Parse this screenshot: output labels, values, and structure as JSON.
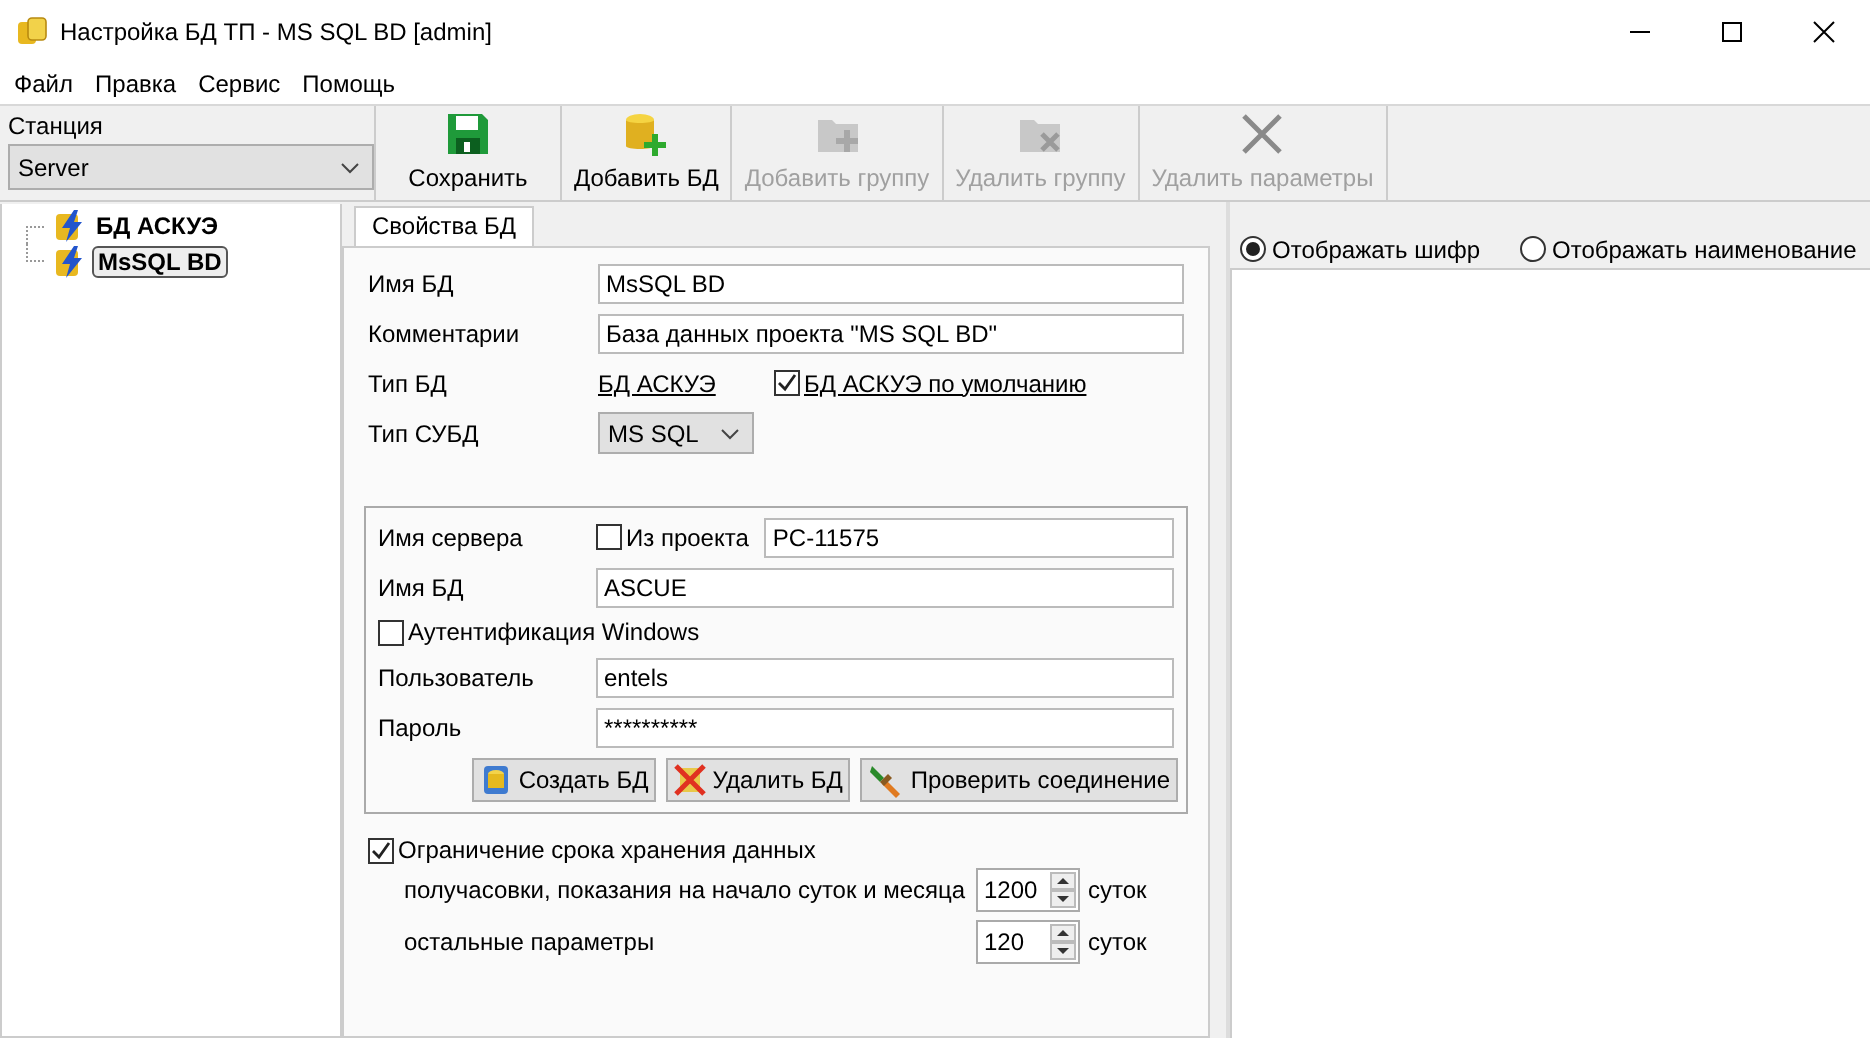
{
  "window": {
    "title": "Настройка БД ТП - MS SQL BD [admin]"
  },
  "menu": [
    "Файл",
    "Правка",
    "Сервис",
    "Помощь"
  ],
  "station": {
    "label": "Станция",
    "value": "Server"
  },
  "toolbar": [
    {
      "label": "Сохранить",
      "disabled": false
    },
    {
      "label": "Добавить БД",
      "disabled": false
    },
    {
      "label": "Добавить группу",
      "disabled": true
    },
    {
      "label": "Удалить группу",
      "disabled": true
    },
    {
      "label": "Удалить параметры",
      "disabled": true
    }
  ],
  "tree": [
    {
      "label": "БД АСКУЭ",
      "selected": false
    },
    {
      "label": "MsSQL BD",
      "selected": true
    }
  ],
  "tab": {
    "label": "Свойства БД",
    "selected": true
  },
  "properties": {
    "name_label": "Имя БД",
    "name": "MsSQL BD",
    "comment_label": "Комментарии",
    "comment": "База данных проекта \"MS SQL BD\"",
    "type_label": "Тип БД",
    "type_link": "БД АСКУЭ",
    "default": {
      "label": "БД АСКУЭ по умолчанию",
      "checked": true
    },
    "dbms_label": "Тип СУБД",
    "dbms": "MS SQL"
  },
  "connection": {
    "server_label": "Имя сервера",
    "from_project": {
      "label": "Из проекта",
      "checked": false
    },
    "server": "PC-11575",
    "db_label": "Имя БД",
    "db": "ASCUE",
    "windows_auth": {
      "label": "Аутентификация Windows",
      "checked": false
    },
    "user_label": "Пользователь",
    "user": "entels",
    "password_label": "Пароль",
    "password": "**********",
    "buttons": [
      {
        "label": "Создать БД"
      },
      {
        "label": "Удалить БД"
      },
      {
        "label": "Проверить соединение"
      }
    ]
  },
  "retention": {
    "label": "Ограничение срока хранения данных",
    "checked": true,
    "rows": [
      {
        "label": "получасовки, показания на начало суток и месяца",
        "value": "1200",
        "unit": "суток"
      },
      {
        "label": "остальные параметры",
        "value": "120",
        "unit": "суток"
      }
    ]
  },
  "display": [
    {
      "label": "Отображать шифр",
      "selected": true
    },
    {
      "label": "Отображать наименование",
      "selected": false
    }
  ]
}
